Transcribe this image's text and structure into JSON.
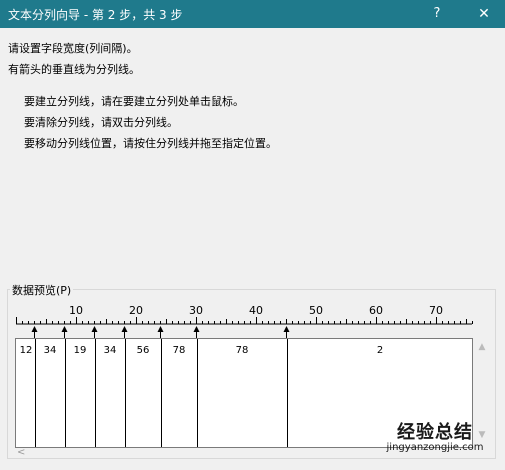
{
  "window": {
    "title": "文本分列向导 - 第 2 步，共 3 步",
    "help_label": "?",
    "close_label": "✕"
  },
  "instructions": {
    "line1": "请设置字段宽度(列间隔)。",
    "line2": "有箭头的垂直线为分列线。",
    "bullet1": "要建立分列线，请在要建立分列处单击鼠标。",
    "bullet2": "要清除分列线，请双击分列线。",
    "bullet3": "要移动分列线位置，请按住分列线并拖至指定位置。"
  },
  "preview": {
    "label": "数据预览(P)",
    "ruler_labels": [
      "10",
      "20",
      "30",
      "40",
      "50",
      "60",
      "70"
    ],
    "ruler_max": 76,
    "break_columns": [
      3,
      8,
      13,
      18,
      24,
      30,
      45
    ],
    "cells": [
      "12",
      "34",
      "19",
      "34",
      "56",
      "78",
      "78",
      "2"
    ]
  },
  "watermark": {
    "text": "经验总结",
    "sub": "jingyanzongjie.com"
  }
}
